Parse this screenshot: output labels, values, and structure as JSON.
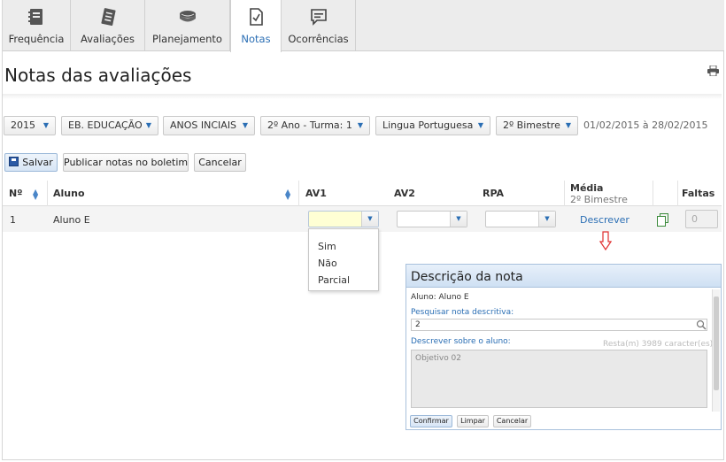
{
  "tabs": [
    {
      "label": "Frequência",
      "icon": "notebook-icon"
    },
    {
      "label": "Avaliações",
      "icon": "checklist-icon"
    },
    {
      "label": "Planejamento",
      "icon": "book-stack-icon"
    },
    {
      "label": "Notas",
      "icon": "checked-document-icon",
      "active": true
    },
    {
      "label": "Ocorrências",
      "icon": "message-icon"
    }
  ],
  "page": {
    "title": "Notas das avaliações"
  },
  "filters": {
    "year": "2015",
    "education": "EB. EDUCAÇÃO",
    "level": "ANOS INCIAIS",
    "class": "2º Ano - Turma: 1",
    "subject": "Lingua Portuguesa",
    "period": "2º Bimestre",
    "range": "01/02/2015 à 28/02/2015"
  },
  "actions": {
    "save": "Salvar",
    "publish": "Publicar notas no boletim",
    "cancel": "Cancelar"
  },
  "table": {
    "headers": {
      "no": "Nº",
      "student": "Aluno",
      "av1": "AV1",
      "av2": "AV2",
      "rpa": "RPA",
      "media": "Média",
      "media_sub": "2º Bimestre",
      "faltas": "Faltas"
    },
    "rows": [
      {
        "no": "1",
        "student": "Aluno E",
        "media_link": "Descrever",
        "faltas": "0"
      }
    ]
  },
  "dropdown": {
    "options": [
      "Sim",
      "Não",
      "Parcial"
    ]
  },
  "dialog": {
    "title": "Descrição da nota",
    "student": "Aluno: Aluno E",
    "search_label": "Pesquisar nota descritiva:",
    "search_value": "2",
    "describe_label": "Descrever sobre o aluno:",
    "remaining": "Resta(m) 3989 caracter(es)",
    "text": "Objetivo 02",
    "buttons": {
      "confirm": "Confirmar",
      "clear": "Limpar",
      "cancel": "Cancelar"
    }
  },
  "colors": {
    "accent": "#2a6eb4",
    "arrow": "#e03030",
    "dialog_header": "#cfe0f3"
  }
}
